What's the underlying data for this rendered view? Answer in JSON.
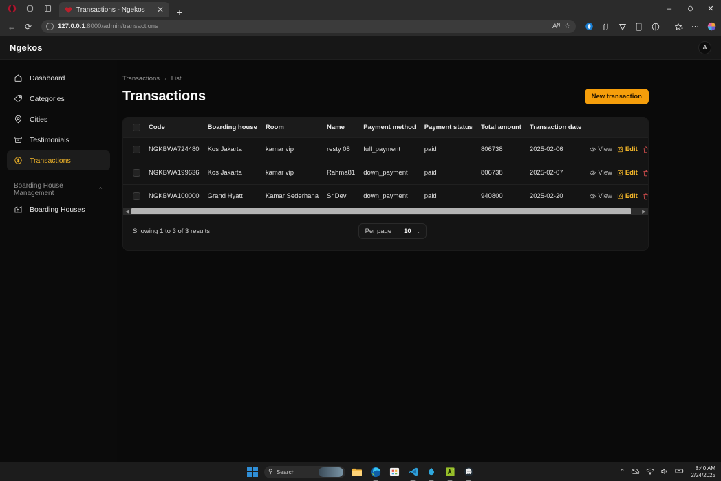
{
  "browser": {
    "tab": {
      "title": "Transactions - Ngekos",
      "close_label": "✕",
      "favicon_name": "ngekos-favicon"
    },
    "new_tab_label": "+",
    "window_controls": {
      "minimize": "–",
      "maximize": "❐",
      "close": "✕"
    },
    "nav": {
      "back": "←",
      "refresh": "⟳"
    },
    "omnibox": {
      "url_host": "127.0.0.1",
      "url_rest": ":8000/admin/transactions",
      "read_aloud": "Aᴺ",
      "favorite": "☆"
    },
    "toolbar_icons": [
      "copilot-icon",
      "browser-essentials-icon",
      "vpn-icon",
      "mobile-icon",
      "split-screen-icon",
      "favorites-icon",
      "settings-more-icon",
      "profile-icon"
    ]
  },
  "app": {
    "brand": "Ngekos",
    "avatar_initial": "A"
  },
  "sidebar": {
    "items": [
      {
        "label": "Dashboard",
        "icon": "home-icon",
        "active": false
      },
      {
        "label": "Categories",
        "icon": "tag-icon",
        "active": false
      },
      {
        "label": "Cities",
        "icon": "map-pin-icon",
        "active": false
      },
      {
        "label": "Testimonials",
        "icon": "archive-icon",
        "active": false
      },
      {
        "label": "Transactions",
        "icon": "coin-dollar-icon",
        "active": true
      }
    ],
    "group": {
      "label": "Boarding House Management",
      "chevron": "⌃"
    },
    "group_items": [
      {
        "label": "Boarding Houses",
        "icon": "building-icon"
      }
    ]
  },
  "main": {
    "breadcrumb": {
      "root": "Transactions",
      "separator": "›",
      "current": "List"
    },
    "title": "Transactions",
    "new_button": "New transaction",
    "table": {
      "headers": [
        "Code",
        "Boarding house",
        "Room",
        "Name",
        "Payment method",
        "Payment status",
        "Total amount",
        "Transaction date"
      ],
      "rows": [
        {
          "code": "NGKBWA724480",
          "boarding_house": "Kos Jakarta",
          "room": "kamar vip",
          "name": "resty 08",
          "payment_method": "full_payment",
          "payment_status": "paid",
          "total_amount": "806738",
          "transaction_date": "2025-02-06"
        },
        {
          "code": "NGKBWA199636",
          "boarding_house": "Kos Jakarta",
          "room": "kamar vip",
          "name": "Rahma81",
          "payment_method": "down_payment",
          "payment_status": "paid",
          "total_amount": "806738",
          "transaction_date": "2025-02-07"
        },
        {
          "code": "NGKBWA100000",
          "boarding_house": "Grand Hyatt",
          "room": "Kamar Sederhana",
          "name": "SriDevi",
          "payment_method": "down_payment",
          "payment_status": "paid",
          "total_amount": "940800",
          "transaction_date": "2025-02-20"
        }
      ],
      "actions": {
        "view": "View",
        "edit": "Edit",
        "delete_icon": "trash-icon"
      }
    },
    "footer": {
      "results_text": "Showing 1 to 3 of 3 results",
      "per_page_label": "Per page",
      "per_page_value": "10",
      "per_page_chevron": "⌄"
    }
  },
  "taskbar": {
    "search_placeholder": "Search",
    "apps": [
      "file-explorer-icon",
      "edge-icon",
      "microsoft-store-icon",
      "vscode-icon",
      "laravel-herd-icon",
      "xampp-icon",
      "ghost-app-icon"
    ],
    "tray": {
      "overflow": "⌃",
      "onedrive": "onedrive-icon",
      "wifi": "wifi-icon",
      "volume": "volume-icon",
      "battery": "battery-icon"
    },
    "clock_time": "8:40 AM",
    "clock_date": "2/24/2025"
  },
  "colors": {
    "accent": "#f59e0b",
    "accent_text": "#f0b429",
    "danger": "#e05252",
    "app_bg": "#0a0a0a",
    "card_bg": "#141414"
  }
}
